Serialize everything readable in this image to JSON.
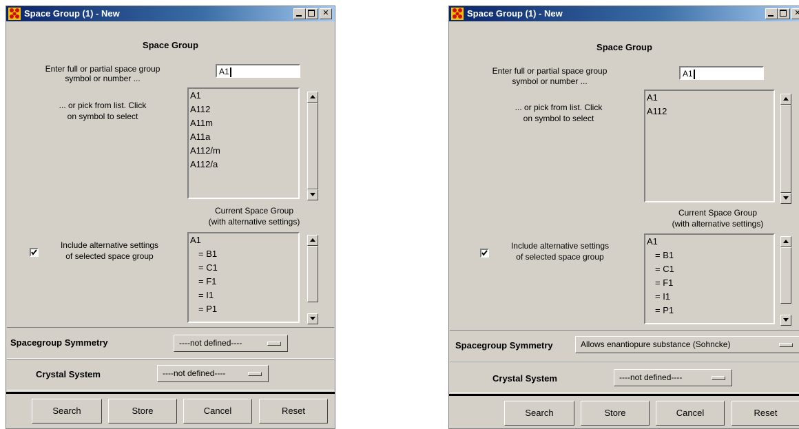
{
  "windows": [
    {
      "title": "Space Group (1) - New",
      "section_title": "Space Group",
      "prompt_line1": "Enter full or partial space group",
      "prompt_line2": "symbol or number ...",
      "search_value": "A1",
      "pick_line1": "... or pick from list. Click",
      "pick_line2": "on symbol to select",
      "symbol_list": [
        "A1",
        "A112",
        "A11m",
        "A11a",
        "A112/m",
        "A112/a"
      ],
      "current_label_line1": "Current Space Group",
      "current_label_line2": "(with alternative settings)",
      "include_alt_line1": "Include alternative settings",
      "include_alt_line2": "of selected space group",
      "include_alt_checked": true,
      "settings_list": [
        "A1",
        "= B1",
        "= C1",
        "= F1",
        "= I1",
        "= P1"
      ],
      "symmetry_label": "Spacegroup Symmetry",
      "symmetry_value": "----not defined----",
      "crystal_label": "Crystal System",
      "crystal_value": "----not defined----",
      "buttons": {
        "search": "Search",
        "store": "Store",
        "cancel": "Cancel",
        "reset": "Reset"
      }
    },
    {
      "title": "Space Group (1) - New",
      "section_title": "Space Group",
      "prompt_line1": "Enter full or partial space group",
      "prompt_line2": "symbol or number ...",
      "search_value": "A1",
      "pick_line1": "... or pick from list. Click",
      "pick_line2": "on symbol to select",
      "symbol_list": [
        "A1",
        "A112"
      ],
      "current_label_line1": "Current Space Group",
      "current_label_line2": "(with alternative settings)",
      "include_alt_line1": "Include alternative settings",
      "include_alt_line2": "of selected space group",
      "include_alt_checked": true,
      "settings_list": [
        "A1",
        "= B1",
        "= C1",
        "= F1",
        "= I1",
        "= P1"
      ],
      "symmetry_label": "Spacegroup Symmetry",
      "symmetry_value": "Allows enantiopure substance (Sohncke)",
      "crystal_label": "Crystal System",
      "crystal_value": "----not defined----",
      "buttons": {
        "search": "Search",
        "store": "Store",
        "cancel": "Cancel",
        "reset": "Reset"
      }
    }
  ]
}
